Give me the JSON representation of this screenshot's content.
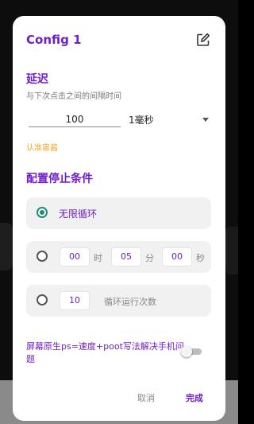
{
  "dialog": {
    "title": "Config 1",
    "colors": {
      "accent": "#6f1ec8",
      "radio_selected": "#1e8c79",
      "link": "#f4a623"
    }
  },
  "delay": {
    "section_title": "延迟",
    "hint": "与下次点击之间的间隔时间",
    "value": "100",
    "unit": "1毫秒",
    "confirm_link": "认准宙酱"
  },
  "stop_conditions": {
    "section_title": "配置停止条件",
    "infinite": {
      "label": "无限循环",
      "selected": true
    },
    "duration": {
      "selected": false,
      "hours": "00",
      "hours_unit": "时",
      "minutes": "05",
      "minutes_unit": "分",
      "seconds": "00",
      "seconds_unit": "秒"
    },
    "count": {
      "selected": false,
      "value": "10",
      "label": "循环运行次数"
    }
  },
  "fix_option": {
    "label": "屏幕原生ps=速度+poot写法解决手机问题",
    "enabled": false
  },
  "actions": {
    "cancel": "取消",
    "done": "完成"
  },
  "icons": {
    "edit": "edit-icon",
    "dropdown": "caret-down-icon"
  }
}
